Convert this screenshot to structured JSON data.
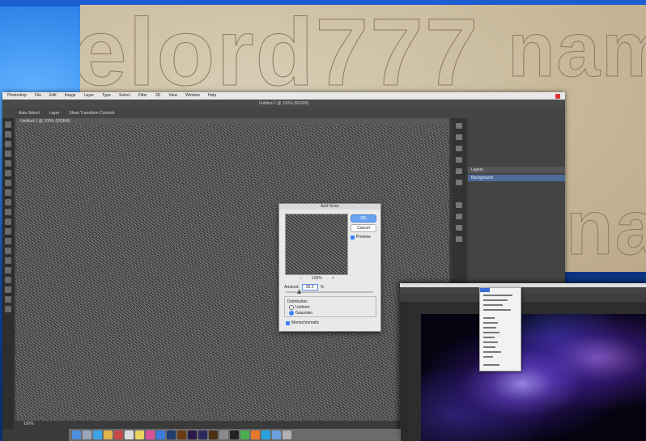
{
  "stone": {
    "text_left": "elord777",
    "text_right_top": "nam",
    "text_right_bottom": "nam"
  },
  "ps": {
    "menubar": [
      "Photoshop",
      "File",
      "Edit",
      "Image",
      "Layer",
      "Type",
      "Select",
      "Filter",
      "3D",
      "View",
      "Window",
      "Help"
    ],
    "doc_title": "Untitled-1 @ 100% (RGB/8)",
    "doc_tab": "Untitled-1 @ 100% (RGB/8)",
    "options": [
      "Auto-Select",
      "Layer",
      "Show Transform Controls"
    ],
    "statusbar": "100%",
    "panels": {
      "layers_title": "Layers",
      "layer_name": "Background"
    }
  },
  "dialog": {
    "title": "Add Noise",
    "ok": "OK",
    "cancel": "Cancel",
    "preview": "Preview",
    "zoom_minus": "−",
    "zoom": "100%",
    "zoom_plus": "+",
    "amount_label": "Amount:",
    "amount_value": "25.0",
    "amount_unit": "%",
    "distribution": "Distribution",
    "uniform": "Uniform",
    "gaussian": "Gaussian",
    "monochromatic": "Monochromatic"
  },
  "colors": {
    "desktop_blue": "#0d3f8f",
    "ps_gray": "#3a3a3a",
    "ok_blue": "#6aa3f0"
  },
  "dock_icons": [
    "finder-icon",
    "launchpad-icon",
    "safari-icon",
    "mail-icon",
    "photos-icon",
    "calendar-icon",
    "notes-icon",
    "itunes-icon",
    "appstore-icon",
    "photoshop-icon",
    "illustrator-icon",
    "premiere-icon",
    "aftereffects-icon",
    "bridge-icon",
    "preferences-icon",
    "terminal-icon",
    "chrome-icon",
    "firefox-icon",
    "skype-icon",
    "folder-icon",
    "trash-icon"
  ]
}
